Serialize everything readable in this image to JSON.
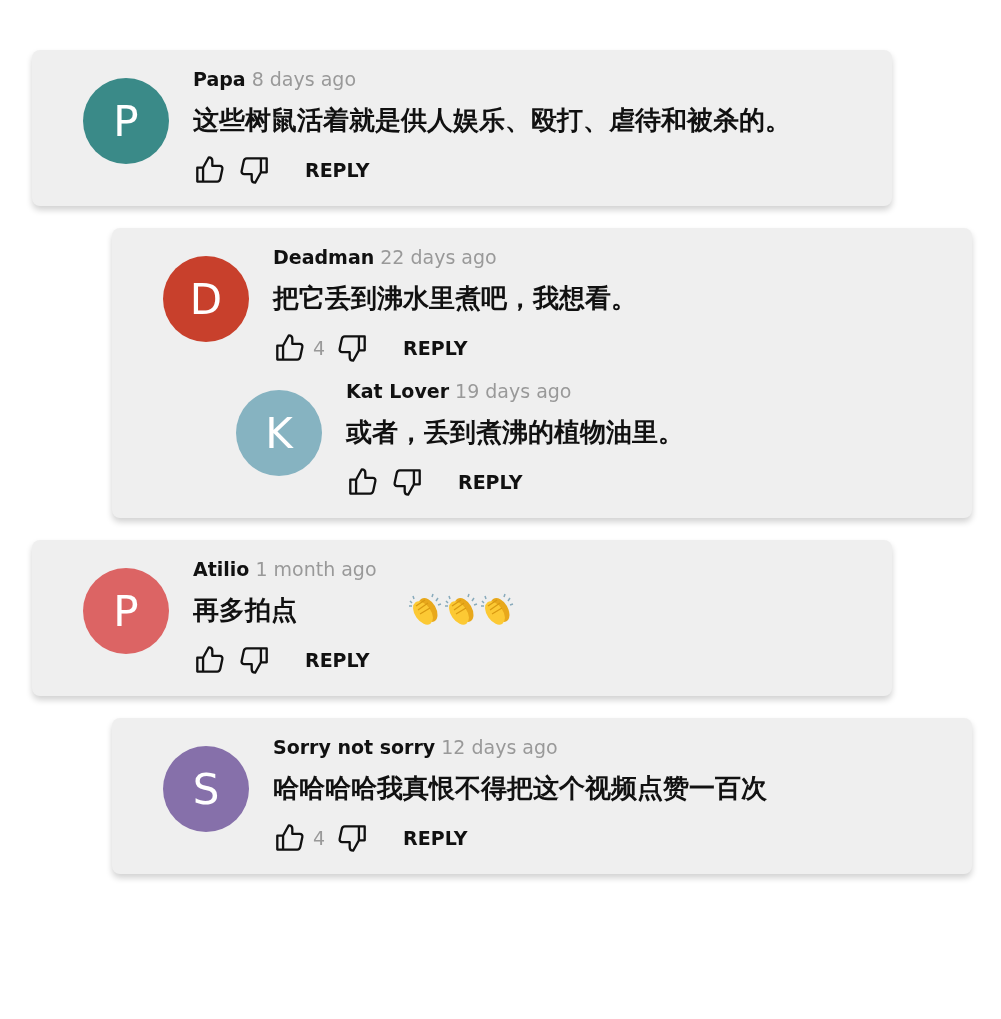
{
  "cards": [
    {
      "comments": [
        {
          "avatar": "P",
          "color": "#3a8a88",
          "author": "Papa",
          "time": "8 days ago",
          "text": "这些树鼠活着就是供人娱乐、殴打、虐待和被杀的。",
          "reply": "REPLY"
        }
      ]
    },
    {
      "comments": [
        {
          "avatar": "D",
          "color": "#c8402c",
          "author": "Deadman",
          "time": "22 days ago",
          "text": "把它丢到沸水里煮吧，我想看。",
          "likes": "4",
          "reply": "REPLY",
          "children": [
            {
              "avatar": "K",
              "color": "#86b3c1",
              "author": "Kat Lover",
              "time": "19 days ago",
              "text": "或者，丢到煮沸的植物油里。",
              "reply": "REPLY"
            }
          ]
        }
      ]
    },
    {
      "comments": [
        {
          "avatar": "P",
          "color": "#dc6464",
          "author": "Atilio",
          "time": "1 month ago",
          "text": "再多拍点",
          "icons": [
            {
              "kind": "clap"
            },
            {
              "kind": "clap"
            },
            {
              "kind": "clap"
            }
          ],
          "reply": "REPLY"
        }
      ]
    },
    {
      "comments": [
        {
          "avatar": "S",
          "color": "#8670aa",
          "author": "Sorry not sorry",
          "time": "12 days ago",
          "text": "哈哈哈哈我真恨不得把这个视频点赞一百次",
          "likes": "4",
          "reply": "REPLY"
        }
      ]
    }
  ]
}
